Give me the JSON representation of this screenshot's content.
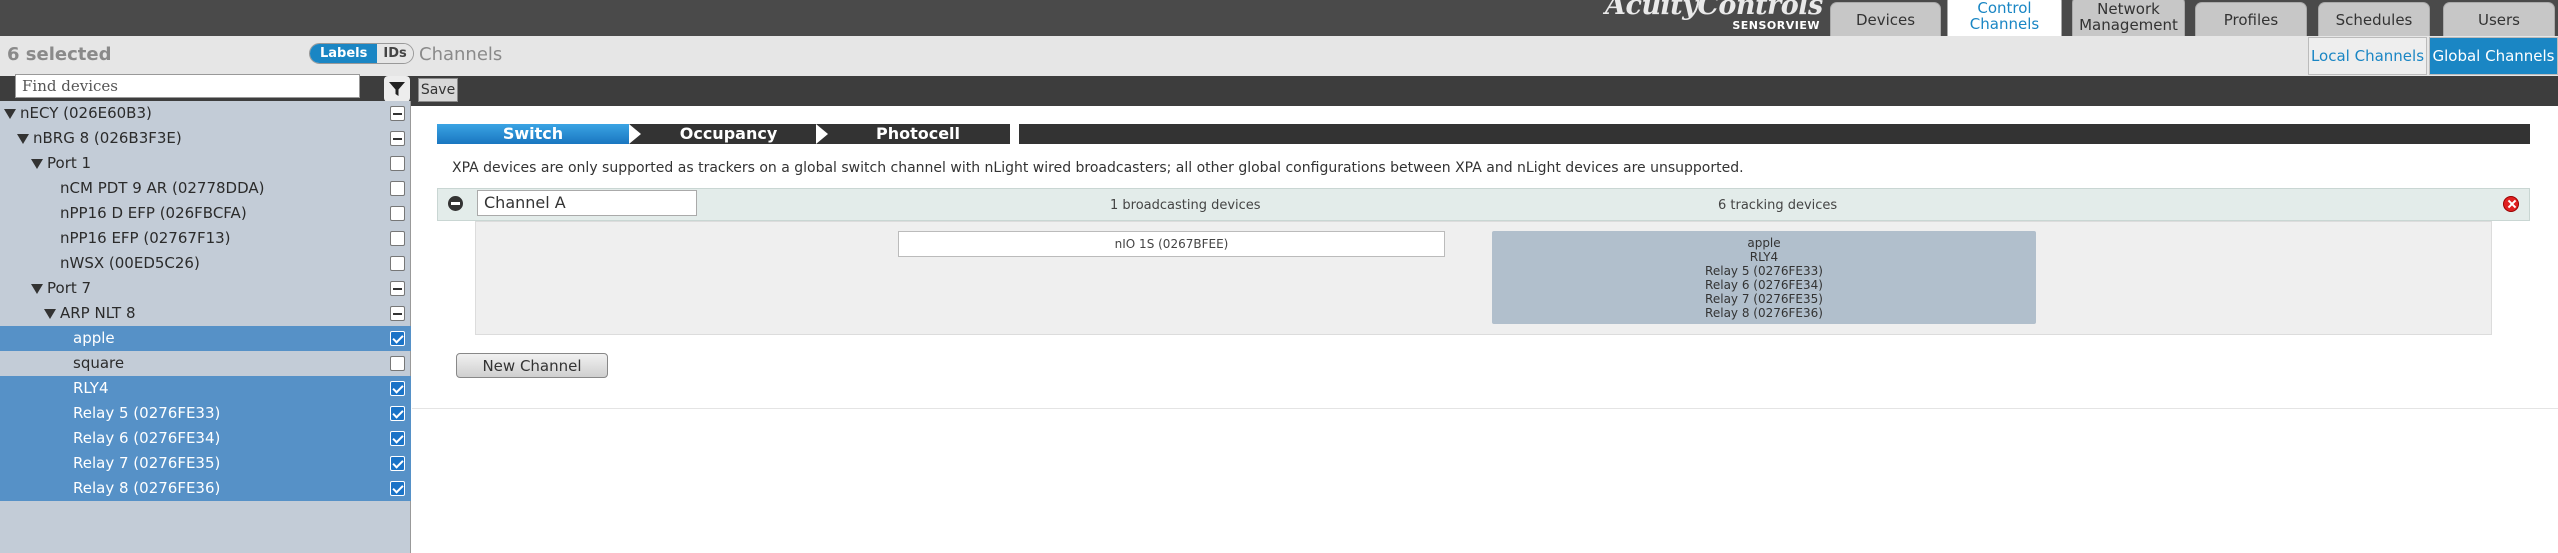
{
  "header": {
    "brand": "AcuityControls",
    "brand_sub": "SENSORVIEW",
    "tabs": [
      {
        "label": "Devices"
      },
      {
        "label": "Control\nChannels"
      },
      {
        "label": "Network\nManagement"
      },
      {
        "label": "Profiles"
      },
      {
        "label": "Schedules"
      },
      {
        "label": "Users"
      }
    ]
  },
  "subheader": {
    "selected_count": "6 selected",
    "toggle": {
      "labels": "Labels",
      "ids": "IDs"
    },
    "title": "Channels",
    "tabs": {
      "local": "Local Channels",
      "global": "Global Channels"
    }
  },
  "toolbar": {
    "search_placeholder": "Find devices",
    "filter_icon": "filter-icon",
    "save": "Save"
  },
  "tree": [
    {
      "label": "nECY (026E60B3)",
      "checkbox": "partial"
    },
    {
      "label": "nBRG 8 (026B3F3E)",
      "checkbox": "partial"
    },
    {
      "label": "Port 1",
      "checkbox": "empty"
    },
    {
      "label": "nCM PDT 9 AR (02778DDA)",
      "checkbox": "empty"
    },
    {
      "label": "nPP16 D EFP (026FBCFA)",
      "checkbox": "empty"
    },
    {
      "label": "nPP16 EFP (02767F13)",
      "checkbox": "empty"
    },
    {
      "label": "nWSX (00ED5C26)",
      "checkbox": "empty"
    },
    {
      "label": "Port 7",
      "checkbox": "partial"
    },
    {
      "label": "ARP NLT 8",
      "checkbox": "partial"
    },
    {
      "label": "apple",
      "checkbox": "checked",
      "selected": true
    },
    {
      "label": "square",
      "checkbox": "empty"
    },
    {
      "label": "RLY4",
      "checkbox": "checked",
      "selected": true
    },
    {
      "label": "Relay 5 (0276FE33)",
      "checkbox": "checked",
      "selected": true
    },
    {
      "label": "Relay 6 (0276FE34)",
      "checkbox": "checked",
      "selected": true
    },
    {
      "label": "Relay 7 (0276FE35)",
      "checkbox": "checked",
      "selected": true
    },
    {
      "label": "Relay 8 (0276FE36)",
      "checkbox": "checked",
      "selected": true
    }
  ],
  "steps": [
    "Switch",
    "Occupancy",
    "Photocell"
  ],
  "notice": "XPA devices are only supported as trackers on a global switch channel with nLight wired broadcasters; all other global configurations between XPA and nLight devices are unsupported.",
  "channel": {
    "name": "Channel A",
    "broadcasting_count": "1 broadcasting devices",
    "tracking_count": "6 tracking devices",
    "broadcaster": "nIO 1S (0267BFEE)",
    "trackers": [
      "apple",
      "RLY4",
      "Relay 5 (0276FE33)",
      "Relay 6 (0276FE34)",
      "Relay 7 (0276FE35)",
      "Relay 8 (0276FE36)"
    ]
  },
  "new_channel": "New Channel",
  "colors": {
    "accent": "#1a86c4",
    "selected_row": "#5691c7",
    "header": "#4a4a4a"
  }
}
